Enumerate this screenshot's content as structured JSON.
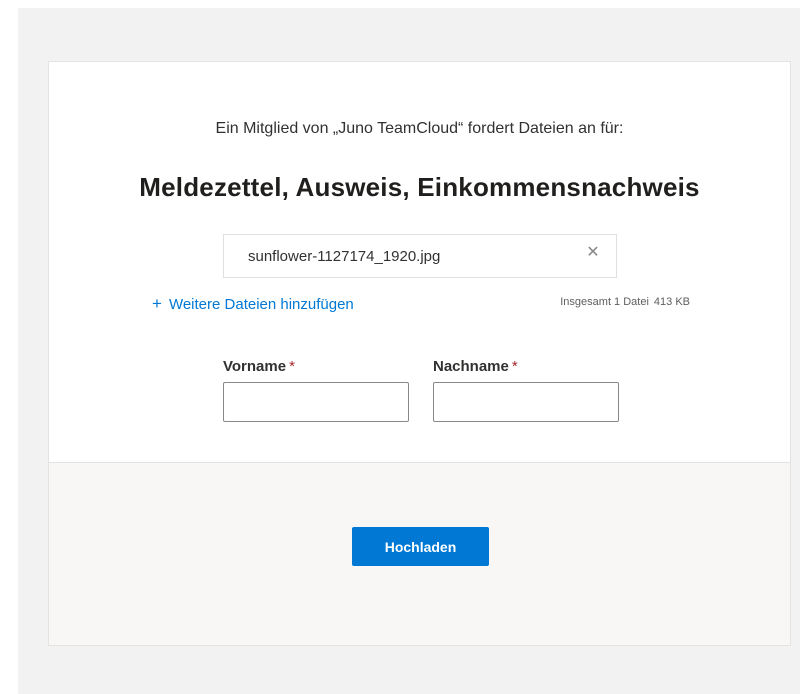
{
  "request": {
    "subtitle": "Ein Mitglied von „Juno TeamCloud“ fordert Dateien an für:",
    "title": "Meldezettel, Ausweis, Einkommensnachweis"
  },
  "files": {
    "items": [
      {
        "name": "sunflower-1127174_1920.jpg",
        "remove_icon": "close-icon"
      }
    ],
    "add_label": "Weitere Dateien hinzufügen",
    "add_icon": "plus-icon",
    "total_label": "Insgesamt 1 Datei",
    "total_size": "413 KB"
  },
  "form": {
    "first_name": {
      "label": "Vorname",
      "required_mark": "*",
      "value": ""
    },
    "last_name": {
      "label": "Nachname",
      "required_mark": "*",
      "value": ""
    }
  },
  "actions": {
    "upload_label": "Hochladen"
  },
  "colors": {
    "accent": "#0078d4",
    "required": "#a4262c",
    "page_background": "#f2f2f2",
    "footer_background": "#f8f7f6"
  }
}
